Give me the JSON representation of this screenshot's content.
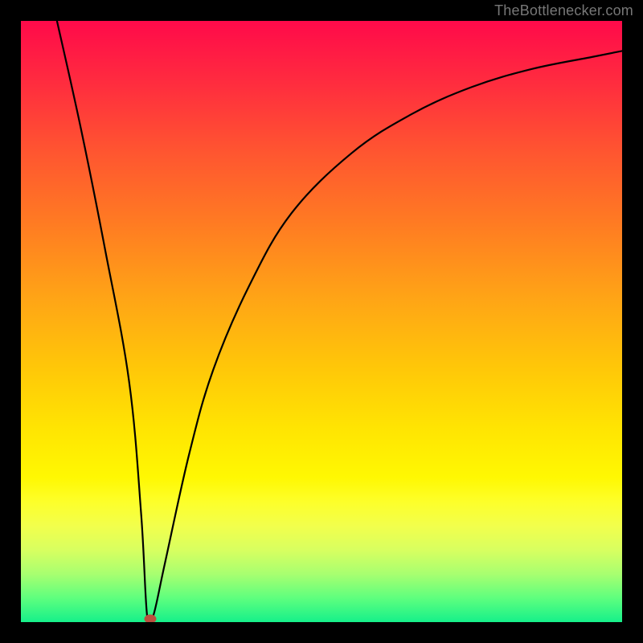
{
  "attribution": "TheBottlenecker.com",
  "chart_data": {
    "type": "line",
    "title": "",
    "xlabel": "",
    "ylabel": "",
    "xlim": [
      0,
      100
    ],
    "ylim": [
      0,
      100
    ],
    "series": [
      {
        "name": "bottleneck-curve",
        "x": [
          6,
          10,
          14,
          18,
          20,
          21,
          22,
          24,
          28,
          32,
          38,
          45,
          55,
          65,
          75,
          85,
          95,
          100
        ],
        "y": [
          100,
          82,
          62,
          40,
          18,
          1,
          1,
          10,
          28,
          42,
          56,
          68,
          78,
          84.5,
          89,
          92,
          94,
          95
        ]
      }
    ],
    "marker": {
      "x": 21.5,
      "y": 0.5
    },
    "gradient_stops": [
      {
        "pct": 0,
        "color": "#ff0a4a"
      },
      {
        "pct": 50,
        "color": "#ffb000"
      },
      {
        "pct": 78,
        "color": "#fff700"
      },
      {
        "pct": 100,
        "color": "#16f08a"
      }
    ]
  }
}
